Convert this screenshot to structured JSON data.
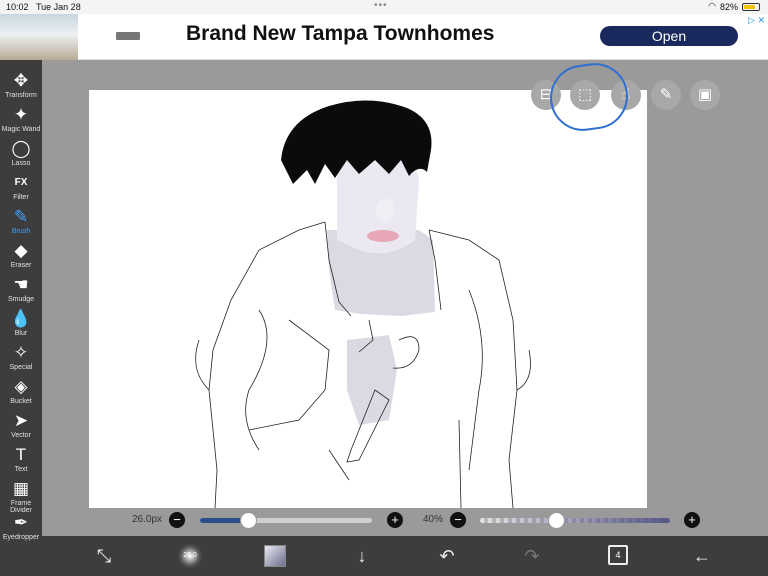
{
  "status": {
    "time": "10:02",
    "date": "Tue Jan 28",
    "battery": "82%",
    "battery_level": 0.82,
    "multitask": "•••"
  },
  "ad": {
    "headline": "Brand New Tampa Townhomes",
    "open_label": "Open",
    "adchoice": "▷ ✕"
  },
  "tools": [
    {
      "label": "Transform",
      "icon": "✥",
      "active": false
    },
    {
      "label": "Magic Wand",
      "icon": "✦",
      "active": false
    },
    {
      "label": "Lasso",
      "icon": "◯",
      "active": false
    },
    {
      "label": "Filter",
      "icon": "FX",
      "active": false
    },
    {
      "label": "Brush",
      "icon": "✎",
      "active": true
    },
    {
      "label": "Eraser",
      "icon": "◆",
      "active": false
    },
    {
      "label": "Smudge",
      "icon": "☚",
      "active": false
    },
    {
      "label": "Blur",
      "icon": "💧",
      "active": false
    },
    {
      "label": "Special",
      "icon": "✧",
      "active": false
    },
    {
      "label": "Bucket",
      "icon": "◈",
      "active": false
    },
    {
      "label": "Vector",
      "icon": "➤",
      "active": false
    },
    {
      "label": "Text",
      "icon": "T",
      "active": false
    },
    {
      "label": "Frame Divider",
      "icon": "▦",
      "active": false
    },
    {
      "label": "Eyedropper",
      "icon": "✒",
      "active": false
    }
  ],
  "floating_buttons": [
    {
      "name": "layer-toggle-icon",
      "glyph": "⊟"
    },
    {
      "name": "selection-icon",
      "glyph": "⬚"
    },
    {
      "name": "hand-icon",
      "glyph": "☝"
    },
    {
      "name": "pen-icon",
      "glyph": "✎"
    },
    {
      "name": "image-icon",
      "glyph": "▣"
    }
  ],
  "sliders": {
    "brush_size": {
      "value_label": "26.0px",
      "level": 0.28,
      "minus": "−",
      "plus": "+"
    },
    "opacity": {
      "value_label": "40%",
      "level": 0.4,
      "minus": "−",
      "plus": "+"
    }
  },
  "bottom": {
    "brush_size_preview": "26.0",
    "layer_count": "4",
    "undo": "↶",
    "redo": "↷",
    "download": "↓",
    "back": "←",
    "transform": "⤡"
  },
  "colors": {
    "toolbar_bg": "#3d3d3d",
    "active_tool": "#3fa5ff",
    "canvas_bg": "#ffffff",
    "workspace_bg": "#9a9a9a",
    "ad_button": "#1b2a5e",
    "highlight_ring": "#2f6fd0"
  }
}
